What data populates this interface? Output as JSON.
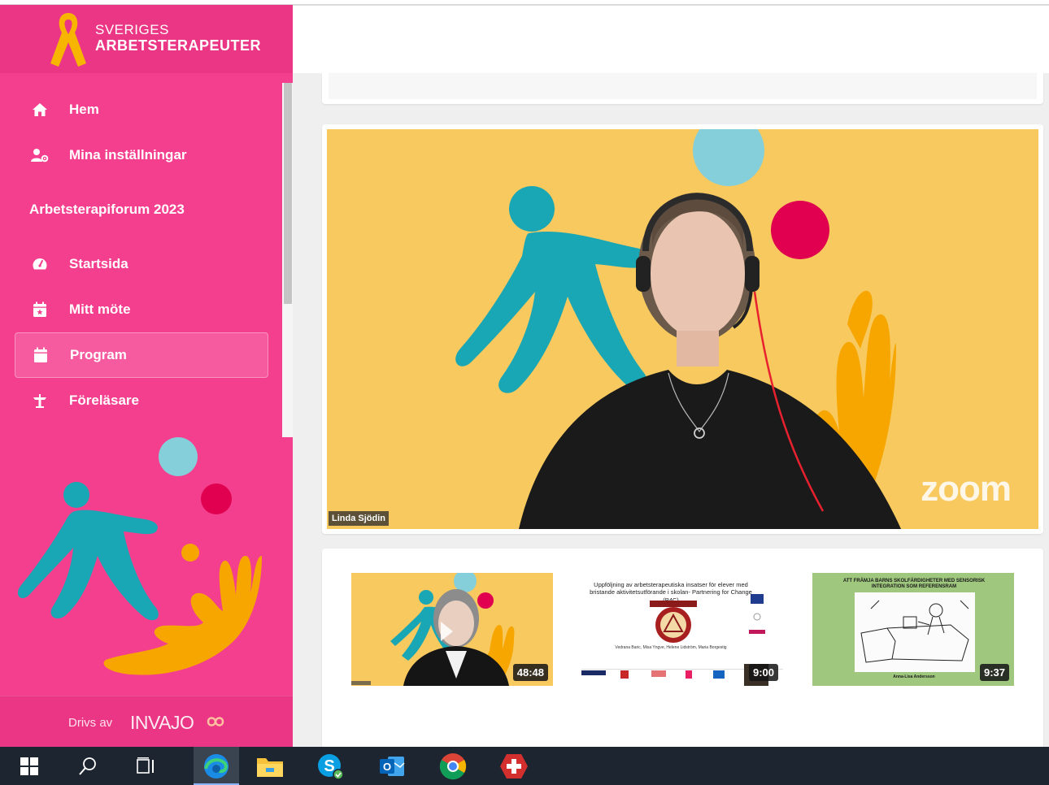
{
  "brand": {
    "line1": "SVERIGES",
    "line2": "ARBETSTERAPEUTER"
  },
  "nav": {
    "items_top": [
      {
        "label": "Hem",
        "icon": "home-icon"
      },
      {
        "label": "Mina inställningar",
        "icon": "user-settings-icon"
      }
    ],
    "section_title": "Arbetsterapiforum 2023",
    "items_section": [
      {
        "label": "Startsida",
        "icon": "dashboard-icon"
      },
      {
        "label": "Mitt möte",
        "icon": "calendar-star-icon"
      },
      {
        "label": "Program",
        "icon": "calendar-icon",
        "active": true
      },
      {
        "label": "Föreläsare",
        "icon": "lectern-icon"
      }
    ]
  },
  "powered": {
    "by": "Drivs av",
    "brand": "INVAJO"
  },
  "video": {
    "speaker_name": "Linda Sjödin",
    "watermark": "zoom"
  },
  "thumbnails": [
    {
      "duration": "48:48"
    },
    {
      "duration": "9:00",
      "title": "Uppföljning av arbetsterapeutiska insatser för elever med bristande aktivitetsutförande i skolan- Partnering for Change (P4C)",
      "authors": "Vedrana Baric, Misa Yngve, Helene Lidström, Maria Borgestig"
    },
    {
      "duration": "9:37",
      "title": "ATT FRÄMJA BARNS SKOLFÄRDIGHETER MED SENSORISK INTEGRATION SOM REFERENSRAM",
      "caption": "Anna-Lisa Andersson"
    }
  ],
  "colors": {
    "sidebar": "#f43f8e",
    "video_bg": "#f7c95f",
    "taskbar": "#1d2530"
  }
}
